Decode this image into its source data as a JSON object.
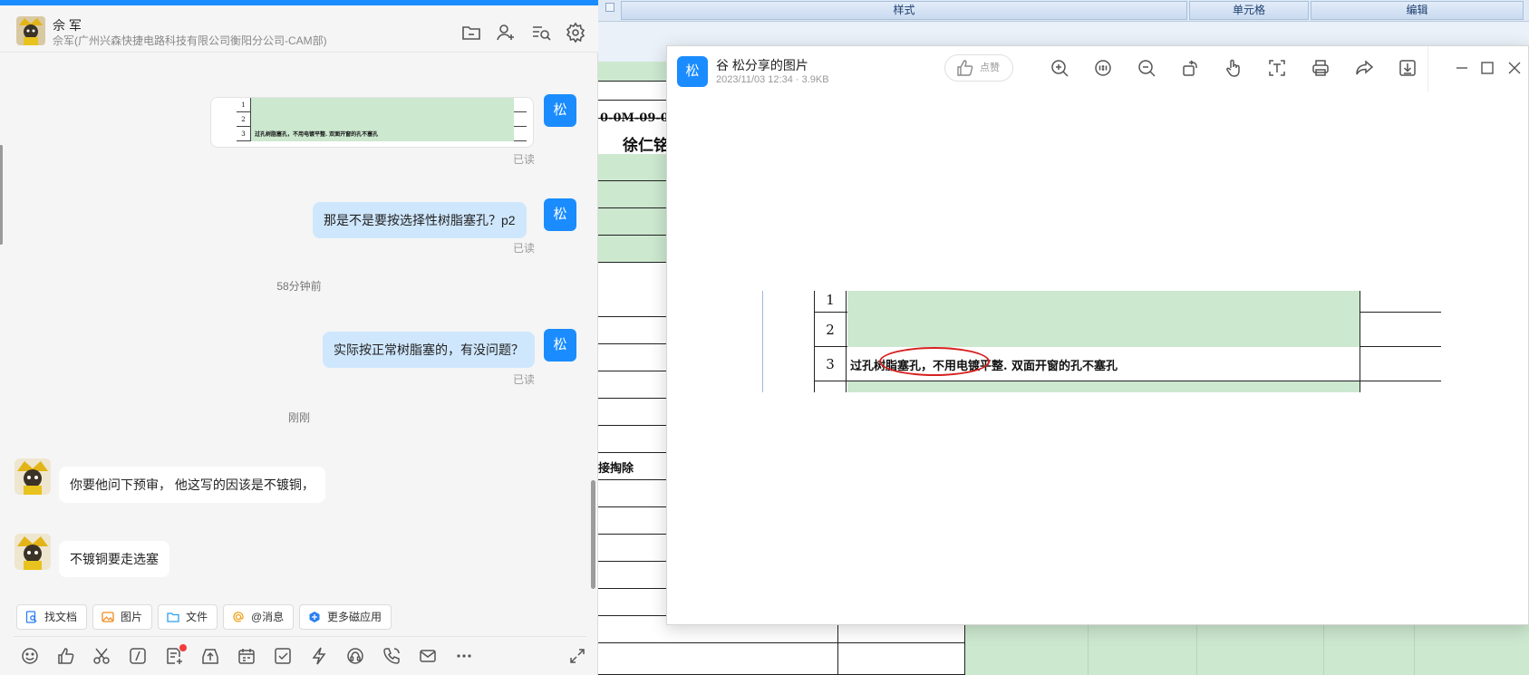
{
  "spreadsheet": {
    "ribbon_groups": [
      "样式",
      "单元格",
      "编辑"
    ],
    "cell_code": "0-0M-09-0",
    "cell_name": "徐仁铭",
    "cell_label": "接掏除"
  },
  "chat": {
    "contact_name": "佘 军",
    "contact_org": "佘军(广州兴森快捷电路科技有限公司衡阳分公司-CAM部)",
    "self_avatar": "松",
    "header_icons": [
      "folder-icon",
      "add-user-icon",
      "search-history-icon",
      "gear-icon"
    ],
    "image_message": {
      "rows": [
        "1",
        "2",
        "3"
      ],
      "row3_text": "过孔树脂塞孔，不用电镀平整. 双面开窗的孔不塞孔",
      "status": "已读"
    },
    "messages": [
      {
        "side": "self",
        "text": "那是不是要按选择性树脂塞孔？p2",
        "status": "已读"
      },
      {
        "type": "time",
        "text": "58分钟前"
      },
      {
        "side": "self",
        "text": "实际按正常树脂塞的，有没问题？",
        "status": "已读"
      },
      {
        "type": "time",
        "text": "刚刚"
      },
      {
        "side": "other",
        "text": "你要他问下预审，  他这写的因该是不镀铜，"
      },
      {
        "side": "other",
        "text": "不镀铜要走选塞"
      }
    ],
    "quick_actions": [
      {
        "label": "找文档",
        "icon": "find-doc-icon"
      },
      {
        "label": "图片",
        "icon": "image-icon"
      },
      {
        "label": "文件",
        "icon": "folder-icon"
      },
      {
        "label": "@消息",
        "icon": "at-icon"
      },
      {
        "label": "更多磁应用",
        "icon": "apps-icon"
      }
    ],
    "toolbar_icons": [
      "emoji-icon",
      "thumbs-up-icon",
      "scissors-icon",
      "slash-command-icon",
      "add-doc-icon",
      "upload-icon",
      "calendar-icon",
      "task-check-icon",
      "lightning-icon",
      "audio-call-icon",
      "phone-icon",
      "mail-icon",
      "more-icon",
      "expand-icon"
    ]
  },
  "viewer": {
    "avatar": "松",
    "title": "谷 松分享的图片",
    "meta": "2023/11/03 12:34 · 3.9KB",
    "like_label": "点赞",
    "tool_icons": [
      "zoom-in-icon",
      "actual-size-icon",
      "zoom-out-icon",
      "rotate-icon",
      "hand-icon",
      "text-recognition-icon",
      "print-icon",
      "share-icon",
      "download-icon"
    ],
    "window_icons": [
      "minimize-icon",
      "maximize-icon",
      "close-icon"
    ],
    "image": {
      "rows": [
        "1",
        "2",
        "3"
      ],
      "row3_text": "过孔树脂塞孔，不用电镀平整. 双面开窗的孔不塞孔"
    }
  }
}
